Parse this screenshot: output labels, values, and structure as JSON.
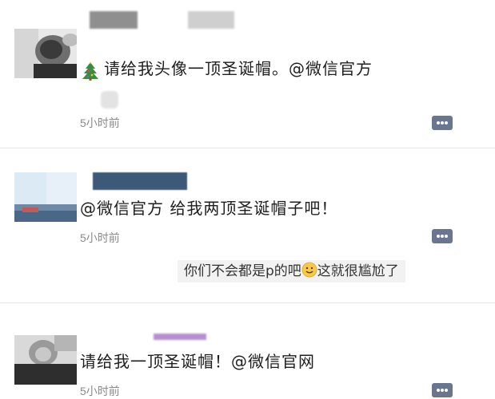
{
  "posts": [
    {
      "text": "请给我头像一顶圣诞帽。@微信官方",
      "time": "5小时前",
      "icons": [
        "christmas-tree-icon",
        "comment-icon"
      ]
    },
    {
      "text": "@微信官方 给我两顶圣诞帽子吧！",
      "time": "5小时前",
      "icons": [
        "comment-icon"
      ],
      "reply": {
        "before": "你们不会都是p的吧",
        "emoji": "smiley-face-icon",
        "after": "这就很尴尬了"
      }
    },
    {
      "text": "请给我一顶圣诞帽！@微信官网",
      "time": "5小时前",
      "icons": [
        "comment-icon"
      ]
    }
  ],
  "colors": {
    "background": "#ffffff",
    "divider": "#e6e6e6",
    "time_text": "#8a8a8a",
    "comment_icon": "#6a7690",
    "reply_bg": "#f2f2f2"
  }
}
